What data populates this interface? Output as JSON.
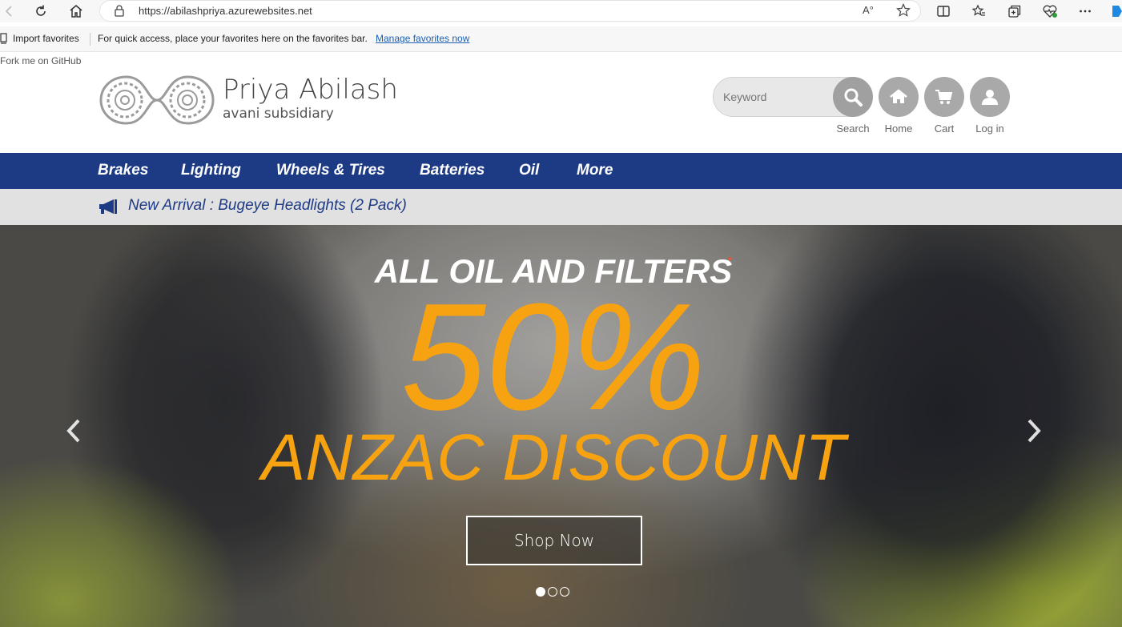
{
  "browser": {
    "url": "https://abilashpriya.azurewebsites.net",
    "read_aloud": "A°"
  },
  "favorites_bar": {
    "import_label": "Import favorites",
    "hint": "For quick access, place your favorites here on the favorites bar.",
    "manage_link": "Manage favorites now"
  },
  "page": {
    "fork_link": "Fork me on GitHub",
    "brand_name": "Priya Abilash",
    "brand_sub": "avani subsidiary",
    "search_placeholder": "Keyword",
    "actions": [
      {
        "label": "Search",
        "icon": "search-icon"
      },
      {
        "label": "Home",
        "icon": "home-icon"
      },
      {
        "label": "Cart",
        "icon": "cart-icon"
      },
      {
        "label": "Log in",
        "icon": "user-icon"
      }
    ],
    "nav": [
      "Brakes",
      "Lighting",
      "Wheels & Tires",
      "Batteries",
      "Oil",
      "More"
    ],
    "announcement": "New Arrival : Bugeye Headlights (2 Pack)"
  },
  "hero": {
    "title": "ALL OIL AND FILTERS",
    "percent": "50%",
    "discount": "ANZAC DISCOUNT",
    "cta": "Shop Now",
    "slides_total": 3,
    "slide_active": 1
  },
  "colors": {
    "nav_bg": "#1d3a85",
    "accent_orange": "#f7a311",
    "announce_bg": "#e1e1e1",
    "icon_circle": "#a9a9a9"
  }
}
